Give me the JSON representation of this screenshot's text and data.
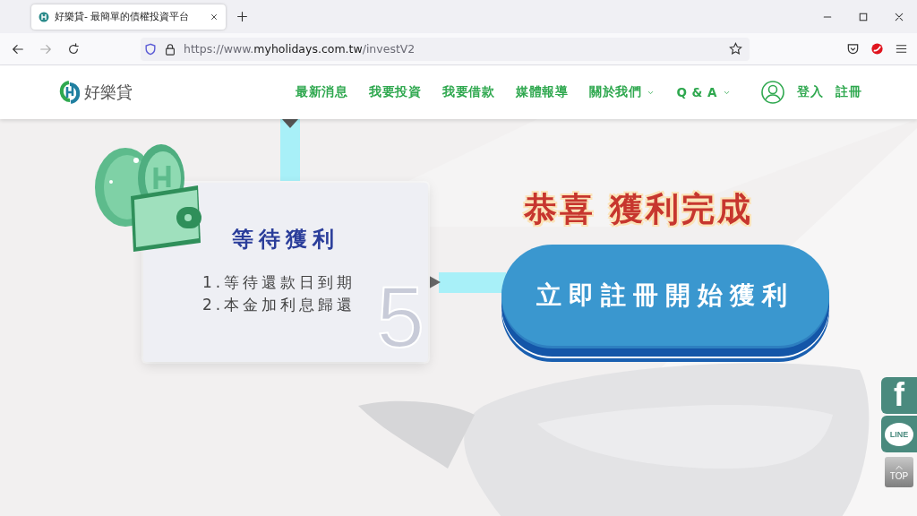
{
  "browser": {
    "tab": {
      "title": "好樂貸- 最簡單的債權投資平台",
      "selected": true
    },
    "address": "https://www.**myholidays.com.tw**/investV2"
  },
  "site_header": {
    "logo_text": "好樂貸",
    "nav": [
      {
        "label": "最新消息",
        "kind": "link"
      },
      {
        "label": "我要投資",
        "kind": "link"
      },
      {
        "label": "我要借款",
        "kind": "link"
      },
      {
        "label": "媒體報導",
        "kind": "link"
      },
      {
        "label": "關於我們",
        "kind": "dropdown"
      },
      {
        "label": "Q & A",
        "kind": "dropdown"
      }
    ],
    "login": "登入",
    "register": "註冊"
  },
  "step_card": {
    "title": "等待獲利",
    "items": [
      "1.等待還款日到期",
      "2.本金加利息歸還"
    ],
    "step_number": "5"
  },
  "congrats": "恭喜 獲利完成",
  "cta_button": "立即註冊開始獲利",
  "side_buttons": [
    {
      "label": "f",
      "kind": "facebook"
    },
    {
      "label": "LINE",
      "kind": "line"
    },
    {
      "label": "TOP",
      "kind": "top"
    }
  ]
}
